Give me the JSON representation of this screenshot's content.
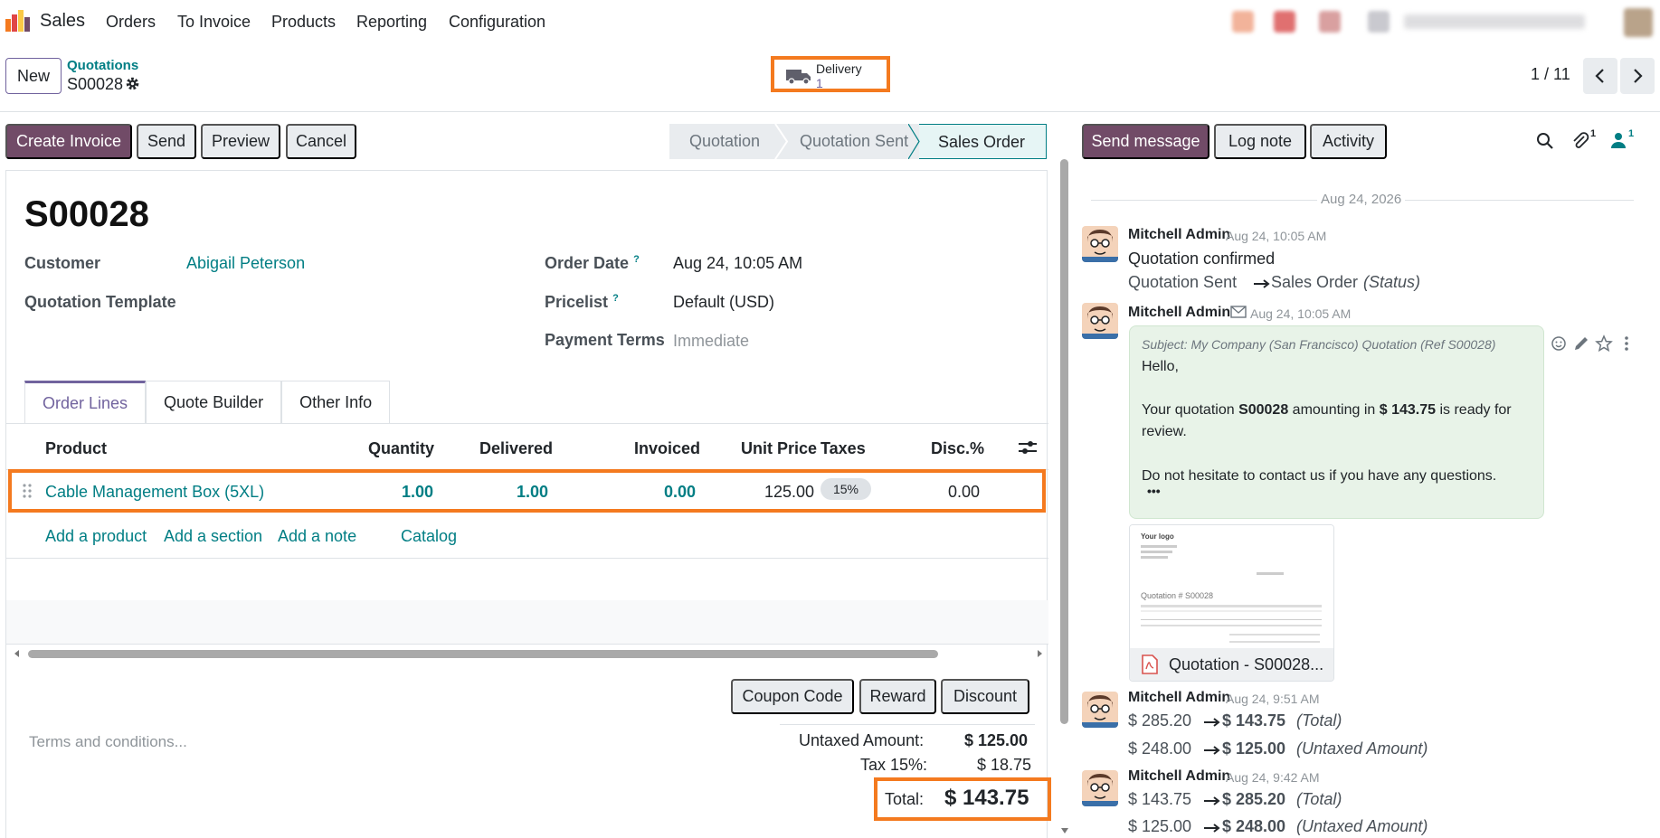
{
  "topnav": {
    "app_name": "Sales",
    "items": [
      "Orders",
      "To Invoice",
      "Products",
      "Reporting",
      "Configuration"
    ]
  },
  "control": {
    "new_label": "New",
    "breadcrumb_parent": "Quotations",
    "breadcrumb_current": "S00028",
    "smart_button": {
      "label": "Delivery",
      "value": "1"
    },
    "pager": "1 / 11"
  },
  "actions": {
    "create_invoice": "Create Invoice",
    "send": "Send",
    "preview": "Preview",
    "cancel": "Cancel"
  },
  "status": {
    "stages": [
      "Quotation",
      "Quotation Sent",
      "Sales Order"
    ],
    "active": "Sales Order"
  },
  "form": {
    "title": "S00028",
    "customer_label": "Customer",
    "customer_value": "Abigail Peterson",
    "template_label": "Quotation Template",
    "order_date_label": "Order Date",
    "order_date_value": "Aug 24, 10:05 AM",
    "pricelist_label": "Pricelist",
    "pricelist_value": "Default (USD)",
    "payment_terms_label": "Payment Terms",
    "payment_terms_placeholder": "Immediate",
    "help_mark": "?"
  },
  "tabs": [
    "Order Lines",
    "Quote Builder",
    "Other Info"
  ],
  "table": {
    "headers": {
      "product": "Product",
      "quantity": "Quantity",
      "delivered": "Delivered",
      "invoiced": "Invoiced",
      "unit_price": "Unit Price",
      "taxes": "Taxes",
      "disc": "Disc.%"
    },
    "rows": [
      {
        "product": "Cable Management Box (5XL)",
        "quantity": "1.00",
        "delivered": "1.00",
        "invoiced": "0.00",
        "unit_price": "125.00",
        "taxes": "15%",
        "disc": "0.00"
      }
    ],
    "add_product": "Add a product",
    "add_section": "Add a section",
    "add_note": "Add a note",
    "catalog": "Catalog"
  },
  "footer": {
    "coupon": "Coupon Code",
    "reward": "Reward",
    "discount": "Discount",
    "terms_placeholder": "Terms and conditions...",
    "untaxed_label": "Untaxed Amount:",
    "untaxed_value": "$ 125.00",
    "tax_label": "Tax 15%:",
    "tax_value": "$ 18.75",
    "total_label": "Total:",
    "total_value": "$ 143.75"
  },
  "chatter": {
    "send_message": "Send message",
    "log_note": "Log note",
    "activity": "Activity",
    "attach_count": "1",
    "follower_count": "1",
    "date_separator": "Aug 24, 2026",
    "messages": [
      {
        "author": "Mitchell Admin",
        "date": "Aug 24, 10:05 AM",
        "body": "Quotation confirmed",
        "from": "Quotation Sent",
        "to": "Sales Order",
        "field": "(Status)"
      },
      {
        "author": "Mitchell Admin",
        "date": "Aug 24, 10:05 AM",
        "subject": "Subject: My Company (San Francisco) Quotation (Ref S00028)",
        "greeting": "Hello,",
        "line1_pre": "Your quotation ",
        "line1_ref": "S00028",
        "line1_mid": " amounting in ",
        "line1_amount": "$ 143.75",
        "line1_post": " is ready for",
        "line2": "review.",
        "line3": "Do not hesitate to contact us if you have any questions.",
        "more": "•••",
        "attachment": "Quotation - S00028..."
      },
      {
        "author": "Mitchell Admin",
        "date": "Aug 24, 9:51 AM",
        "t1_from": "$ 285.20",
        "t1_to": "$ 143.75",
        "t1_field": "(Total)",
        "t2_from": "$ 248.00",
        "t2_to": "$ 125.00",
        "t2_field": "(Untaxed Amount)"
      },
      {
        "author": "Mitchell Admin",
        "date": "Aug 24, 9:42 AM",
        "t1_from": "$ 143.75",
        "t1_to": "$ 285.20",
        "t1_field": "(Total)",
        "t2_from": "$ 125.00",
        "t2_to": "$ 248.00",
        "t2_field": "(Untaxed Amount)"
      }
    ]
  },
  "preview_doc": {
    "logo": "Your logo",
    "heading": "Quotation # S00028"
  }
}
